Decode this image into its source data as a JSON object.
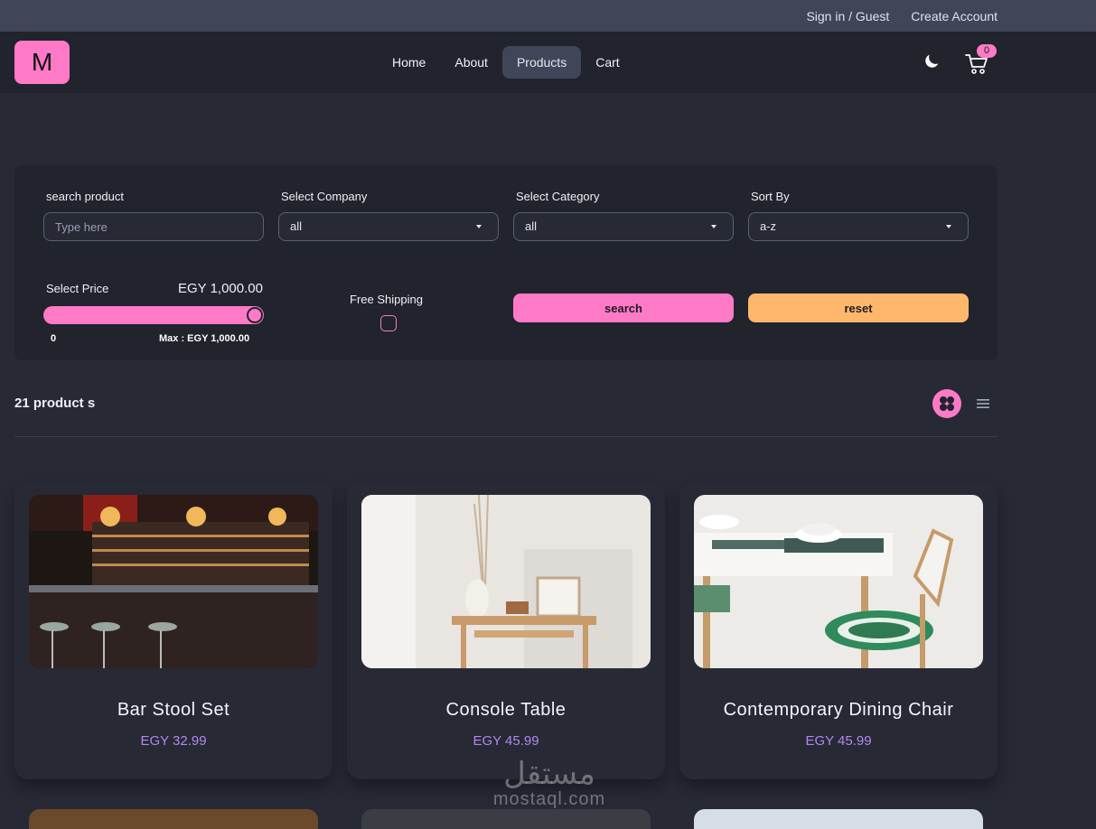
{
  "topbar": {
    "sign_in": "Sign in / Guest",
    "create_account": "Create Account"
  },
  "navbar": {
    "logo": "M",
    "links": [
      "Home",
      "About",
      "Products",
      "Cart"
    ],
    "active_link": "Products",
    "cart_count": "0"
  },
  "filters": {
    "search_label": "search product",
    "search_placeholder": "Type here",
    "company_label": "Select Company",
    "company_value": "all",
    "category_label": "Select Category",
    "category_value": "all",
    "sort_label": "Sort By",
    "sort_value": "a-z",
    "price_label": "Select Price",
    "price_value": "EGY 1,000.00",
    "price_min": "0",
    "price_max": "Max : EGY 1,000.00",
    "price_slider_fraction": 1.0,
    "shipping_label": "Free Shipping",
    "shipping_checked": false,
    "search_button": "search",
    "reset_button": "reset"
  },
  "results": {
    "count": "21 product s"
  },
  "products": [
    {
      "name": "Bar Stool Set",
      "price": "EGY 32.99"
    },
    {
      "name": "Console Table",
      "price": "EGY 45.99"
    },
    {
      "name": "Contemporary Dining Chair",
      "price": "EGY 45.99"
    }
  ],
  "watermark": {
    "arabic": "مستقل",
    "latin": "mostaql.com"
  },
  "colors": {
    "accent_pink": "#ff7ac6",
    "accent_orange": "#ffb86b",
    "price_purple": "#b088f0",
    "background": "#272935"
  }
}
